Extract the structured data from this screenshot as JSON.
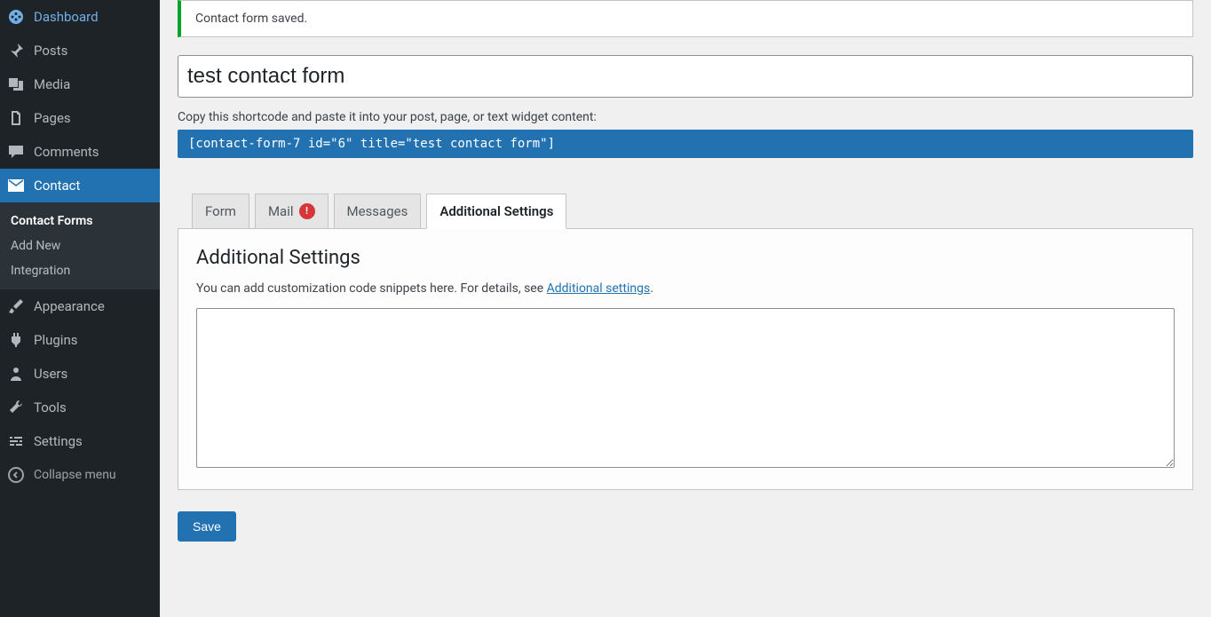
{
  "sidebar": {
    "items": [
      {
        "label": "Dashboard"
      },
      {
        "label": "Posts"
      },
      {
        "label": "Media"
      },
      {
        "label": "Pages"
      },
      {
        "label": "Comments"
      },
      {
        "label": "Contact"
      },
      {
        "label": "Appearance"
      },
      {
        "label": "Plugins"
      },
      {
        "label": "Users"
      },
      {
        "label": "Tools"
      },
      {
        "label": "Settings"
      }
    ],
    "submenu": [
      {
        "label": "Contact Forms"
      },
      {
        "label": "Add New"
      },
      {
        "label": "Integration"
      }
    ],
    "collapse_label": "Collapse menu"
  },
  "notice": {
    "message": "Contact form saved."
  },
  "form": {
    "title": "test contact form",
    "shortcode_label": "Copy this shortcode and paste it into your post, page, or text widget content:",
    "shortcode": "[contact-form-7 id=\"6\" title=\"test contact form\"]"
  },
  "tabs": [
    {
      "label": "Form"
    },
    {
      "label": "Mail",
      "badge": "!"
    },
    {
      "label": "Messages"
    },
    {
      "label": "Additional Settings"
    }
  ],
  "panel": {
    "heading": "Additional Settings",
    "desc_prefix": "You can add customization code snippets here. For details, see ",
    "link_text": "Additional settings",
    "desc_suffix": ".",
    "textarea_value": ""
  },
  "buttons": {
    "save": "Save"
  }
}
